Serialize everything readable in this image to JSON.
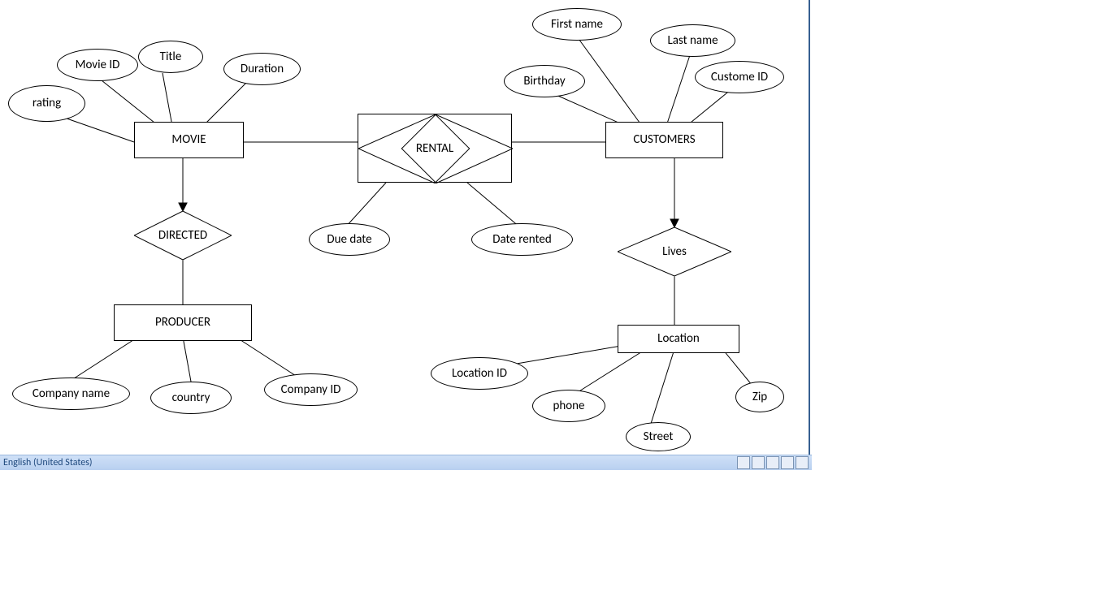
{
  "entities": {
    "movie": "MOVIE",
    "customers": "CUSTOMERS",
    "producer": "PRODUCER",
    "location": "Location"
  },
  "relationships": {
    "rental": "RENTAL",
    "directed": "DIRECTED",
    "lives": "Lives"
  },
  "attributes": {
    "movie_id": "Movie ID",
    "title": "Title",
    "duration": "Duration",
    "rating": "rating",
    "first_name": "First name",
    "last_name": "Last name",
    "birthday": "Birthday",
    "custome_id": "Custome ID",
    "due_date": "Due date",
    "date_rented": "Date rented",
    "company_name": "Company name",
    "country": "country",
    "company_id": "Company ID",
    "location_id": "Location ID",
    "phone": "phone",
    "street": "Street",
    "zip": "Zip"
  },
  "status": {
    "language": "English (United States)"
  }
}
